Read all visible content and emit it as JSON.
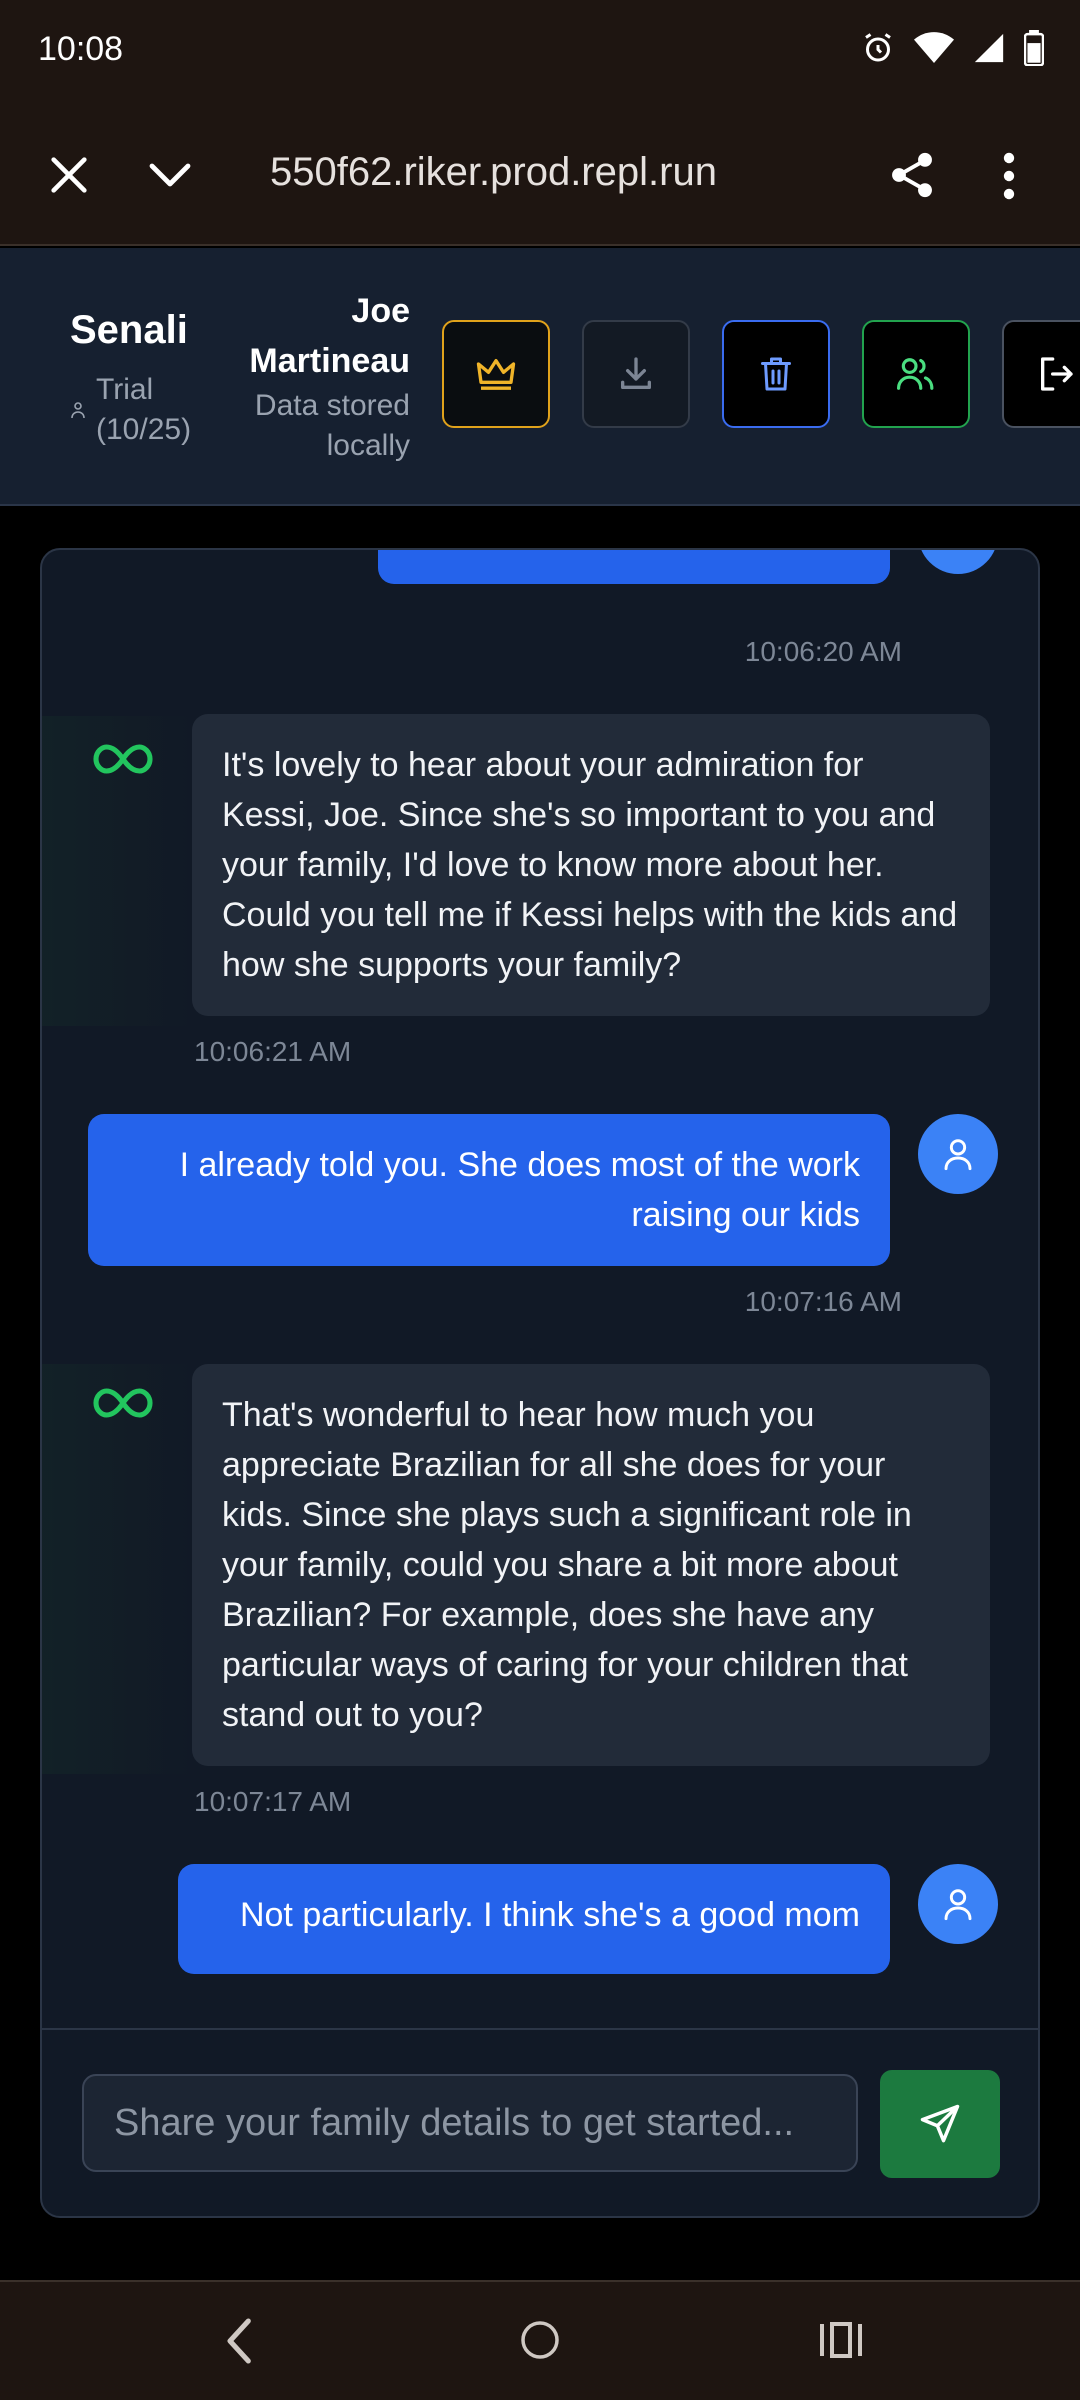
{
  "status_bar": {
    "time": "10:08"
  },
  "browser": {
    "url": "550f62.riker.prod.repl.run"
  },
  "header": {
    "brand": "Senali",
    "plan_label": "Trial",
    "plan_count": "(10/25)",
    "user_name_line1": "Joe",
    "user_name_line2": "Martineau",
    "storage_line1": "Data stored",
    "storage_line2": "locally"
  },
  "messages": [
    {
      "role": "user",
      "text": "",
      "time": "10:06:20 AM"
    },
    {
      "role": "assistant",
      "text": "It's lovely to hear about your admiration for Kessi, Joe. Since she's so important to you and your family, I'd love to know more about her. Could you tell me if Kessi helps with the kids and how she supports your family?",
      "time": "10:06:21 AM"
    },
    {
      "role": "user",
      "text": "I already told you.  She does most of the work raising our kids",
      "time": "10:07:16 AM"
    },
    {
      "role": "assistant",
      "text": "That's wonderful to hear how much you appreciate Brazilian for all she does for your kids. Since she plays such a significant role in your family, could you share a bit more about Brazilian? For example, does she have any particular ways of caring for your children that stand out to you?",
      "time": "10:07:17 AM"
    },
    {
      "role": "user",
      "text": "Not particularly.  I think she's a good mom",
      "time": ""
    }
  ],
  "composer": {
    "placeholder": "Share your family details to get started..."
  },
  "colors": {
    "user_bubble": "#2563eb",
    "ai_bubble": "#222b39",
    "send_button": "#1c7a3f",
    "premium_accent": "#e0a21b",
    "ai_icon": "#22c55e"
  }
}
